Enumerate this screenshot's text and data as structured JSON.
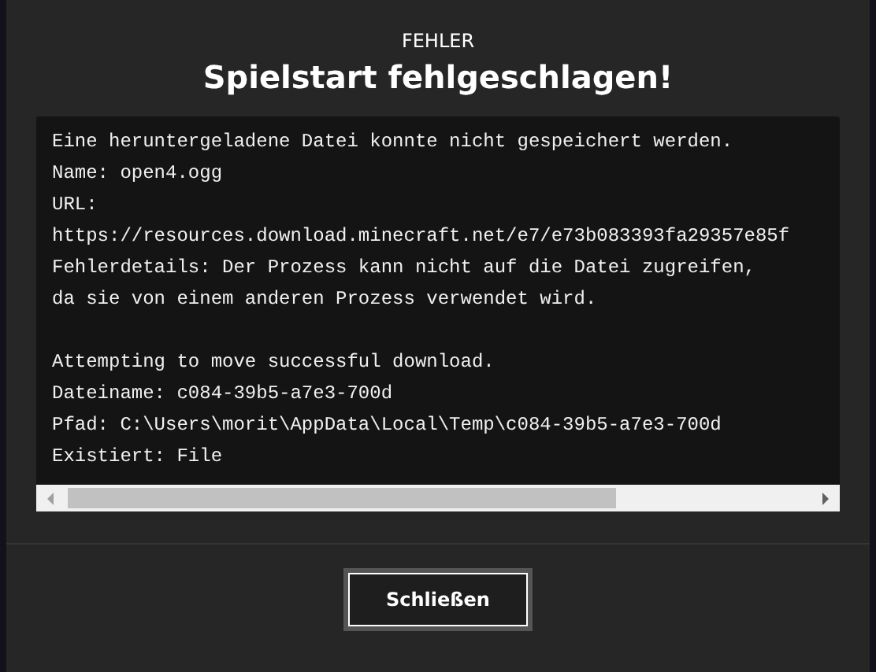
{
  "dialog": {
    "kicker": "FEHLER",
    "title": "Spielstart fehlgeschlagen!",
    "log_paragraphs": [
      [
        "Eine heruntergeladene Datei konnte nicht gespeichert werden.",
        "Name: open4.ogg",
        "URL:",
        "https://resources.download.minecraft.net/e7/e73b083393fa29357e85f",
        "Fehlerdetails: Der Prozess kann nicht auf die Datei zugreifen,",
        "da sie von einem anderen Prozess verwendet wird."
      ],
      [
        "Attempting to move successful download.",
        "Dateiname: c084-39b5-a7e3-700d",
        "Pfad: C:\\Users\\morit\\AppData\\Local\\Temp\\c084-39b5-a7e3-700d",
        "Existiert: File"
      ]
    ],
    "buttons": [
      {
        "label": "Schließen"
      }
    ]
  }
}
